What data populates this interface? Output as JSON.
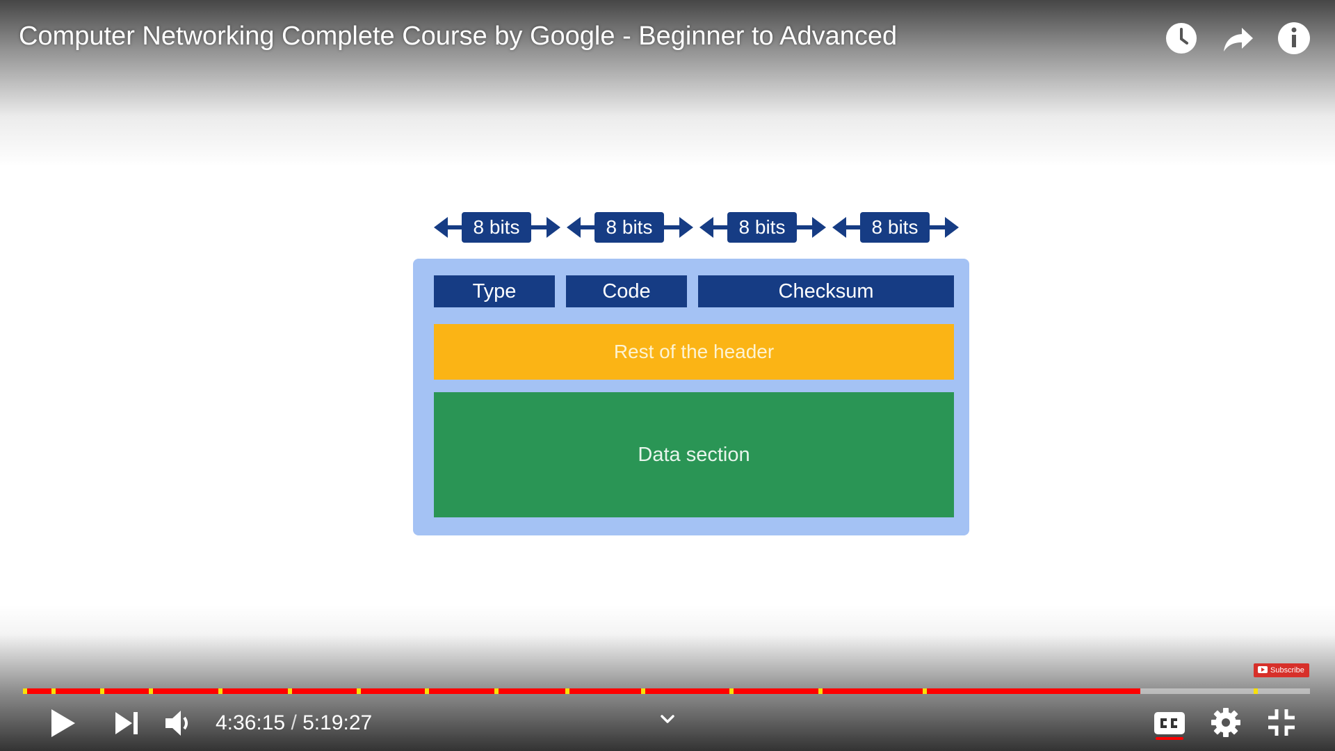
{
  "player": {
    "title": "Computer Networking Complete Course by Google - Beginner to Advanced",
    "time": {
      "current": "4:36:15",
      "separator": "/",
      "duration": "5:19:27"
    },
    "progress_fraction": 0.868,
    "chapter_markers_fraction": [
      0.0,
      0.022,
      0.06,
      0.098,
      0.152,
      0.206,
      0.26,
      0.313,
      0.367,
      0.422,
      0.481,
      0.55,
      0.619,
      0.7,
      0.958
    ],
    "subscribe_label": "Subscribe",
    "colors": {
      "progress": "#ff0000",
      "marker": "#f7e00a",
      "cc_underline": "#ff0000"
    },
    "top_icons": [
      "watch-later-icon",
      "share-icon",
      "info-icon"
    ],
    "bottom_icons": [
      "play-icon",
      "next-icon",
      "volume-icon",
      "chevron-down-icon",
      "closed-captions-icon",
      "settings-gear-icon",
      "exit-fullscreen-icon"
    ]
  },
  "diagram": {
    "bits": [
      "8 bits",
      "8 bits",
      "8 bits",
      "8 bits"
    ],
    "fields": {
      "type": "Type",
      "code": "Code",
      "checksum": "Checksum"
    },
    "rest_of_header": "Rest of the header",
    "data_section": "Data section",
    "colors": {
      "box": "#a4c2f4",
      "field": "#163c84",
      "header": "#fbb415",
      "data": "#2a9555"
    }
  }
}
